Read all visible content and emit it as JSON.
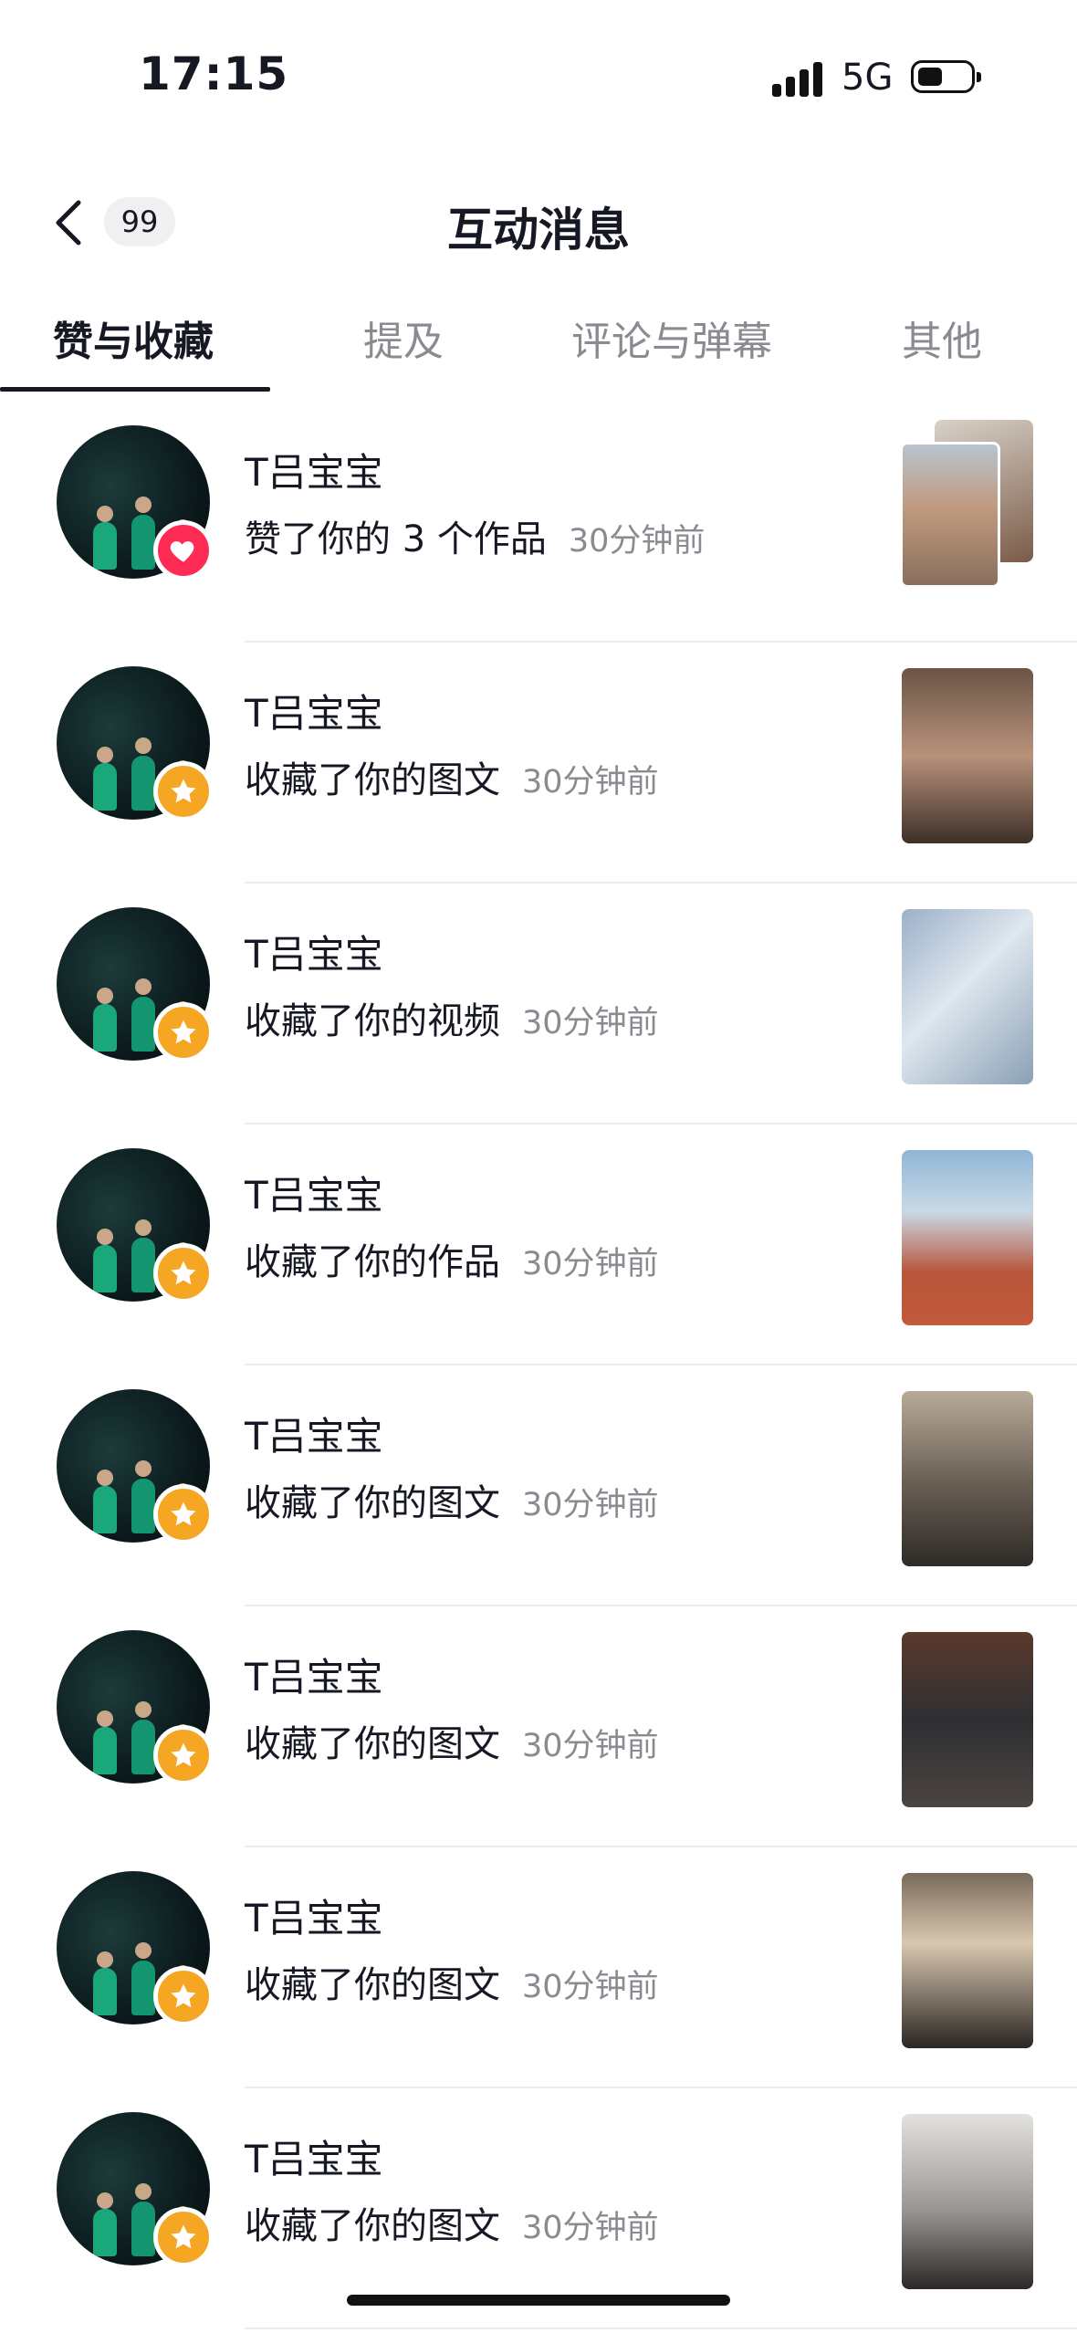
{
  "status_bar": {
    "time": "17:15",
    "network": "5G"
  },
  "header": {
    "back_icon": "chevron-left-icon",
    "unread_count": "99",
    "title": "互动消息"
  },
  "tabs": [
    {
      "label": "赞与收藏",
      "active": true
    },
    {
      "label": "提及",
      "active": false
    },
    {
      "label": "评论与弹幕",
      "active": false
    },
    {
      "label": "其他",
      "active": false
    }
  ],
  "colors": {
    "heart_badge": "#fe2c55",
    "star_badge": "#f5a623",
    "time_gray": "#8a8b91"
  },
  "notifications": [
    {
      "name": "T吕宝宝",
      "action": "赞了你的 3 个作品",
      "time": "30分钟前",
      "badge_icon": "heart-icon"
    },
    {
      "name": "T吕宝宝",
      "action": "收藏了你的图文",
      "time": "30分钟前",
      "badge_icon": "star-icon"
    },
    {
      "name": "T吕宝宝",
      "action": "收藏了你的视频",
      "time": "30分钟前",
      "badge_icon": "star-icon"
    },
    {
      "name": "T吕宝宝",
      "action": "收藏了你的作品",
      "time": "30分钟前",
      "badge_icon": "star-icon"
    },
    {
      "name": "T吕宝宝",
      "action": "收藏了你的图文",
      "time": "30分钟前",
      "badge_icon": "star-icon"
    },
    {
      "name": "T吕宝宝",
      "action": "收藏了你的图文",
      "time": "30分钟前",
      "badge_icon": "star-icon"
    },
    {
      "name": "T吕宝宝",
      "action": "收藏了你的图文",
      "time": "30分钟前",
      "badge_icon": "star-icon"
    },
    {
      "name": "T吕宝宝",
      "action": "收藏了你的图文",
      "time": "30分钟前",
      "badge_icon": "star-icon"
    }
  ]
}
